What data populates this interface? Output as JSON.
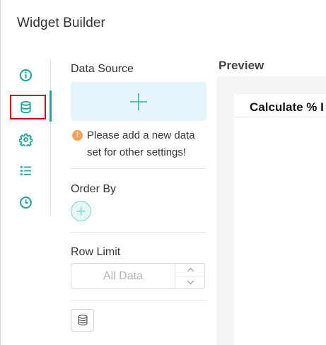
{
  "dialog": {
    "title": "Widget Builder"
  },
  "rail": {
    "items": [
      {
        "icon": "info-icon",
        "active": false
      },
      {
        "icon": "database-icon",
        "active": true
      },
      {
        "icon": "gear-icon",
        "active": false
      },
      {
        "icon": "list-icon",
        "active": false
      },
      {
        "icon": "clock-icon",
        "active": false
      }
    ],
    "accent_color": "#26a69a",
    "highlight_color": "#d0021b"
  },
  "data_source": {
    "label": "Data Source",
    "add_icon": "plus-icon",
    "warning_text": "Please add a new data set for other settings!",
    "warning_color": "#f5a05a",
    "warning_glyph": "!"
  },
  "order_by": {
    "label": "Order By",
    "add_icon": "plus-icon"
  },
  "row_limit": {
    "label": "Row Limit",
    "value": "",
    "placeholder": "All Data"
  },
  "preview": {
    "label": "Preview",
    "card_title": "Calculate % I"
  }
}
